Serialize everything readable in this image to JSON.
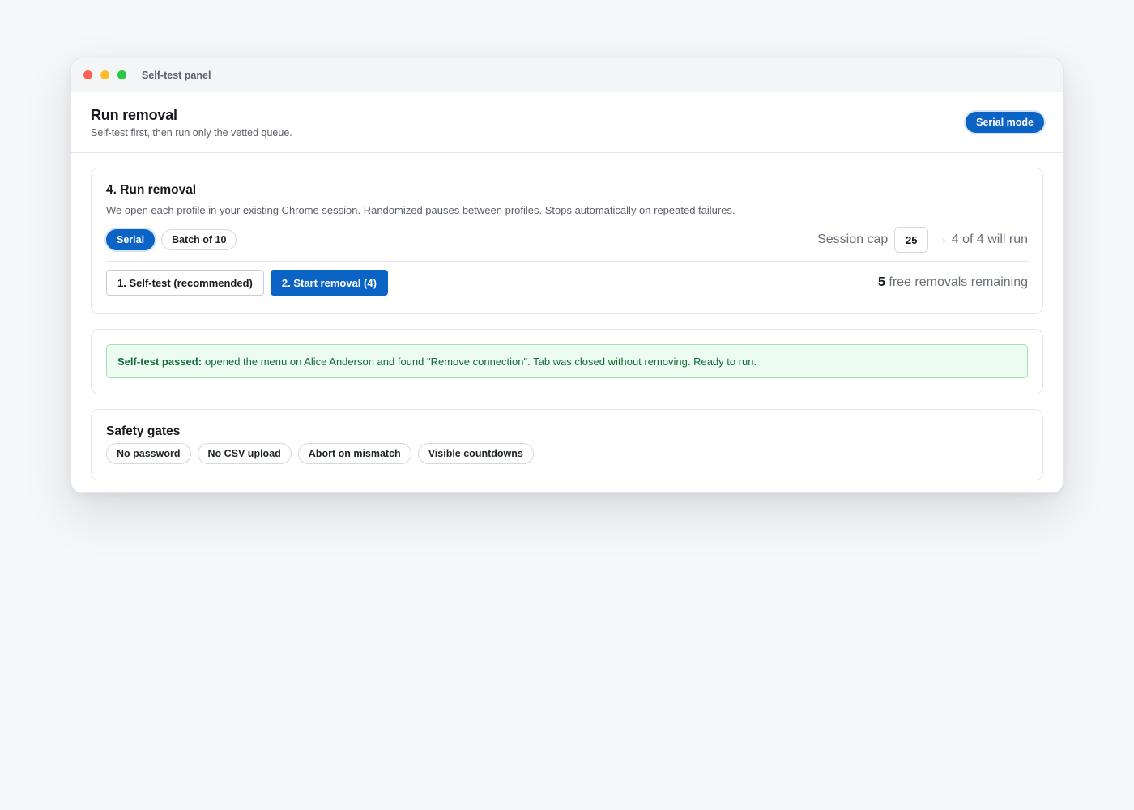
{
  "window": {
    "title": "Self-test panel"
  },
  "header": {
    "title": "Run removal",
    "subtitle": "Self-test first, then run only the vetted queue.",
    "mode_badge": "Serial mode"
  },
  "run_card": {
    "title": "4. Run removal",
    "description": "We open each profile in your existing Chrome session. Randomized pauses between profiles. Stops automatically on repeated failures.",
    "modes": [
      {
        "label": "Serial",
        "active": true
      },
      {
        "label": "Batch of 10",
        "active": false
      }
    ],
    "session_cap_label": "Session cap",
    "session_cap_value": "25",
    "will_run_text": "→ 4 of 4 will run",
    "self_test_button": "1. Self-test (recommended)",
    "start_button": "2. Start removal (4)",
    "remaining_count": "5",
    "remaining_text": "free removals remaining"
  },
  "status_card": {
    "label": "Self-test passed:",
    "message": "opened the menu on Alice Anderson and found \"Remove connection\". Tab was closed without removing. Ready to run."
  },
  "gates_card": {
    "title": "Safety gates",
    "chips": [
      "No password",
      "No CSV upload",
      "Abort on mismatch",
      "Visible countdowns"
    ]
  },
  "colors": {
    "accent": "#0b63c5",
    "success_bg": "#ecfcf1",
    "success_text": "#166b3b"
  }
}
